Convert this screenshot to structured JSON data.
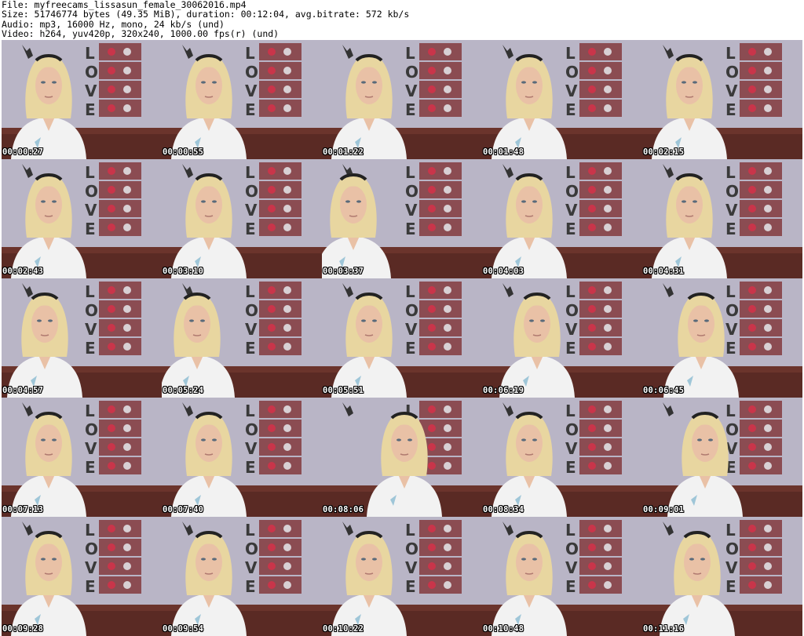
{
  "header": {
    "line1": "File: myfreecams_lissasun_female_30062016.mp4",
    "line2": "Size: 51746774 bytes (49.35 MiB), duration: 00:12:04, avg.bitrate: 572 kb/s",
    "line3": "Audio: mp3, 16000 Hz, mono, 24 kb/s (und)",
    "line4": "Video: h264, yuv420p, 320x240, 1000.00 fps(r) (und)"
  },
  "thumbnails": [
    {
      "timestamp": "00:00:27"
    },
    {
      "timestamp": "00:00:55"
    },
    {
      "timestamp": "00:01:22"
    },
    {
      "timestamp": "00:01:48"
    },
    {
      "timestamp": "00:02:15"
    },
    {
      "timestamp": "00:02:43"
    },
    {
      "timestamp": "00:03:10"
    },
    {
      "timestamp": "00:03:37"
    },
    {
      "timestamp": "00:04:03"
    },
    {
      "timestamp": "00:04:31"
    },
    {
      "timestamp": "00:04:57"
    },
    {
      "timestamp": "00:05:24"
    },
    {
      "timestamp": "00:05:51"
    },
    {
      "timestamp": "00:06:19"
    },
    {
      "timestamp": "00:06:45"
    },
    {
      "timestamp": "00:07:13"
    },
    {
      "timestamp": "00:07:40"
    },
    {
      "timestamp": "00:08:06"
    },
    {
      "timestamp": "00:08:34"
    },
    {
      "timestamp": "00:09:01"
    },
    {
      "timestamp": "00:09:28"
    },
    {
      "timestamp": "00:09:54"
    },
    {
      "timestamp": "00:10:22"
    },
    {
      "timestamp": "00:10:48"
    },
    {
      "timestamp": "00:11:16"
    }
  ],
  "scene": {
    "wall_sign_letters": [
      "L",
      "O",
      "V",
      "E"
    ],
    "colors": {
      "wall": "#b9b5c6",
      "sofa": "#5a2a24",
      "hair": "#e8d6a0",
      "shirt": "#f2f2f2",
      "skin": "#e9c1a6",
      "frame": "#8b4c52",
      "heart": "#c9354a"
    }
  }
}
